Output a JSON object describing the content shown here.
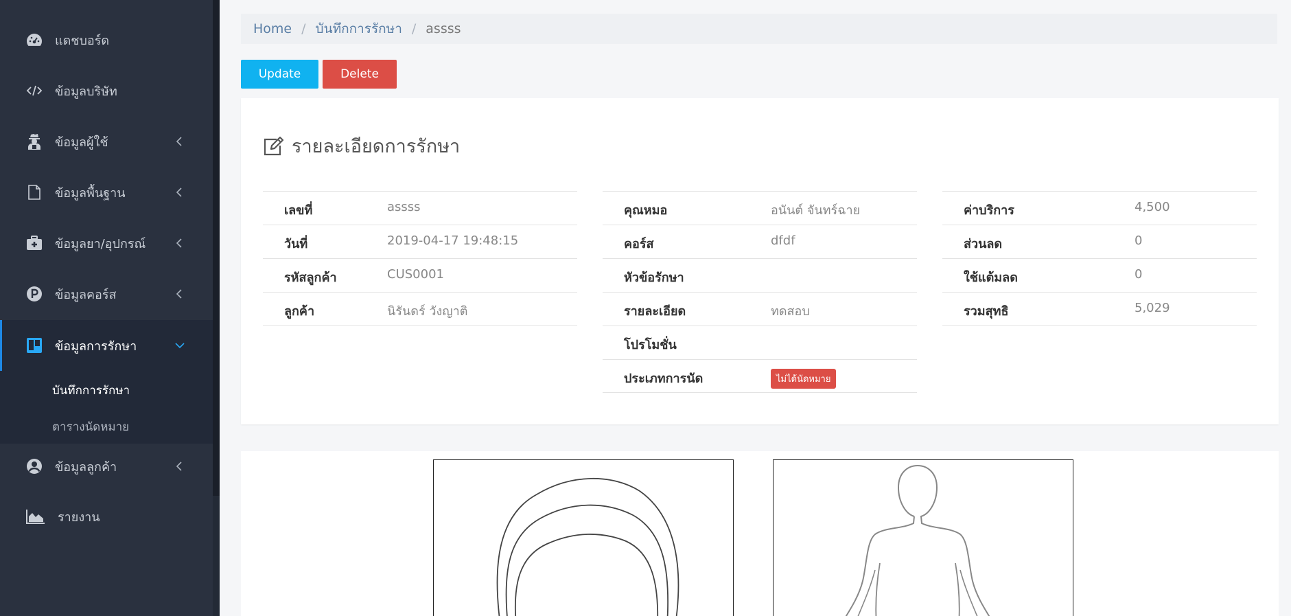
{
  "sidebar": {
    "items": [
      {
        "label": "แดชบอร์ด",
        "icon": "dashboard-icon"
      },
      {
        "label": "ข้อมูลบริษัท",
        "icon": "code-icon"
      },
      {
        "label": "ข้อมูลผู้ใช้",
        "icon": "user-secret-icon"
      },
      {
        "label": "ข้อมูลพื้นฐาน",
        "icon": "file-icon"
      },
      {
        "label": "ข้อมูลยา/อุปกรณ์",
        "icon": "medkit-icon"
      },
      {
        "label": "ข้อมูลคอร์ส",
        "icon": "parking-icon"
      },
      {
        "label": "ข้อมูลการรักษา",
        "icon": "trello-icon"
      },
      {
        "label": "ข้อมูลลูกค้า",
        "icon": "user-circle-icon"
      },
      {
        "label": "รายงาน",
        "icon": "area-chart-icon"
      }
    ],
    "submenu": [
      {
        "label": "บันทึกการรักษา"
      },
      {
        "label": "ตารางนัดหมาย"
      }
    ],
    "accent_color": "#1e88e5"
  },
  "breadcrumb": {
    "home": "Home",
    "section": "บันทึกการรักษา",
    "current": "assss"
  },
  "actions": {
    "update": "Update",
    "delete": "Delete",
    "update_color": "#10b2f0",
    "delete_color": "#dc4e46"
  },
  "detail": {
    "title": "รายละเอียดการรักษา",
    "col1": [
      {
        "label": "เลขที่",
        "value": "assss"
      },
      {
        "label": "วันที่",
        "value": "2019-04-17 19:48:15"
      },
      {
        "label": "รหัสลูกค้า",
        "value": "CUS0001"
      },
      {
        "label": "ลูกค้า",
        "value": "นิรันดร์ วังญาติ"
      }
    ],
    "col2": [
      {
        "label": "คุณหมอ",
        "value": "อนันต์ จันทร์ฉาย"
      },
      {
        "label": "คอร์ส",
        "value": "dfdf"
      },
      {
        "label": "หัวข้อรักษา",
        "value": ""
      },
      {
        "label": "รายละเอียด",
        "value": "ทดสอบ"
      },
      {
        "label": "โปรโมชั่น",
        "value": ""
      },
      {
        "label": "ประเภทการนัด",
        "badge": "ไม่ได้นัดหมาย"
      }
    ],
    "col3": [
      {
        "label": "ค่าบริการ",
        "value": "4,500"
      },
      {
        "label": "ส่วนลด",
        "value": "0"
      },
      {
        "label": "ใช้แต้มลด",
        "value": "0"
      },
      {
        "label": "รวมสุทธิ",
        "value": "5,029"
      }
    ]
  }
}
